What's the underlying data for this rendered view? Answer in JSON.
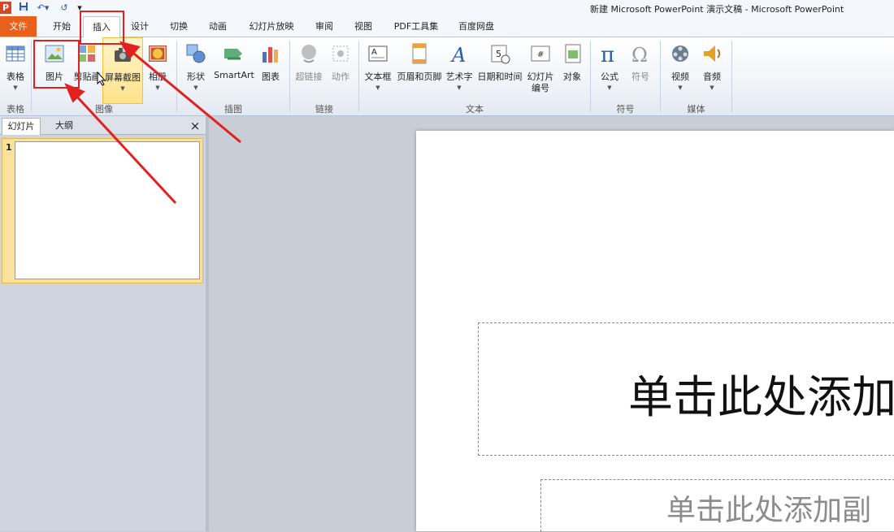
{
  "window": {
    "title": "新建 Microsoft PowerPoint 演示文稿 - Microsoft PowerPoint",
    "app_icon": "P",
    "quick_access": [
      "save-icon",
      "undo-icon",
      "redo-icon",
      "customize-icon"
    ]
  },
  "tabs": [
    {
      "label": "文件"
    },
    {
      "label": "开始"
    },
    {
      "label": "插入"
    },
    {
      "label": "设计"
    },
    {
      "label": "切换"
    },
    {
      "label": "动画"
    },
    {
      "label": "幻灯片放映"
    },
    {
      "label": "审阅"
    },
    {
      "label": "视图"
    },
    {
      "label": "PDF工具集"
    },
    {
      "label": "百度网盘"
    }
  ],
  "ribbon": {
    "buttons": [
      {
        "label": "表格"
      },
      {
        "label": "图片"
      },
      {
        "label": "剪贴画"
      },
      {
        "label": "屏幕截图"
      },
      {
        "label": "相册"
      },
      {
        "label": "形状"
      },
      {
        "label": "SmartArt"
      },
      {
        "label": "图表"
      },
      {
        "label": "超链接"
      },
      {
        "label": "动作"
      },
      {
        "label": "文本框"
      },
      {
        "label": "页眉和页脚"
      },
      {
        "label": "艺术字"
      },
      {
        "label": "日期和时间"
      },
      {
        "label": "幻灯片",
        "label2": "编号"
      },
      {
        "label": "对象"
      },
      {
        "label": "公式"
      },
      {
        "label": "符号"
      },
      {
        "label": "视频"
      },
      {
        "label": "音频"
      }
    ],
    "groups": [
      "表格",
      "图像",
      "插图",
      "链接",
      "文本",
      "符号",
      "媒体"
    ]
  },
  "left_pane": {
    "tabs": [
      "幻灯片",
      "大纲"
    ],
    "close": "×",
    "slide_number": "1"
  },
  "slide": {
    "title_placeholder": "单击此处添加",
    "subtitle_placeholder": "单击此处添加副"
  },
  "colors": {
    "file_tab": "#e8601c",
    "annotation": "#e32020",
    "highlight": "#ffe38a"
  }
}
